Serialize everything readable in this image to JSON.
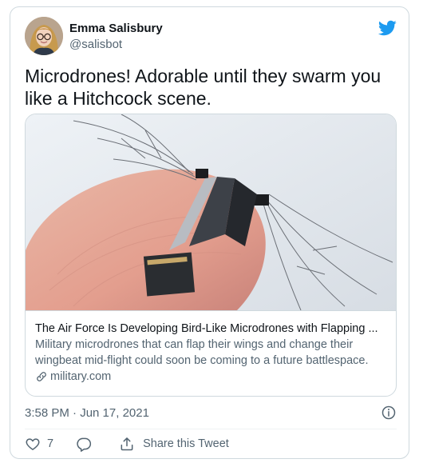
{
  "author": {
    "display_name": "Emma Salisbury",
    "handle": "@salisbot"
  },
  "tweet": {
    "text": "Microdrones! Adorable until they swarm you like a Hitchcock scene."
  },
  "link_card": {
    "title": "The Air Force Is Developing Bird-Like Microdrones with Flapping ...",
    "description": "Military microdrones that can flap their wings and change their wingbeat mid-flight could soon be coming to a future battlespace.",
    "domain": "military.com"
  },
  "meta": {
    "timestamp": "3:58 PM · Jun 17, 2021"
  },
  "actions": {
    "like_count": "7",
    "share_label": "Share this Tweet"
  },
  "colors": {
    "twitter_blue": "#1d9bf0",
    "secondary_text": "#536471",
    "border": "#cfd9de"
  },
  "icons": [
    "bird-logo-icon",
    "link-icon",
    "info-icon",
    "heart-icon",
    "reply-icon",
    "share-icon"
  ]
}
